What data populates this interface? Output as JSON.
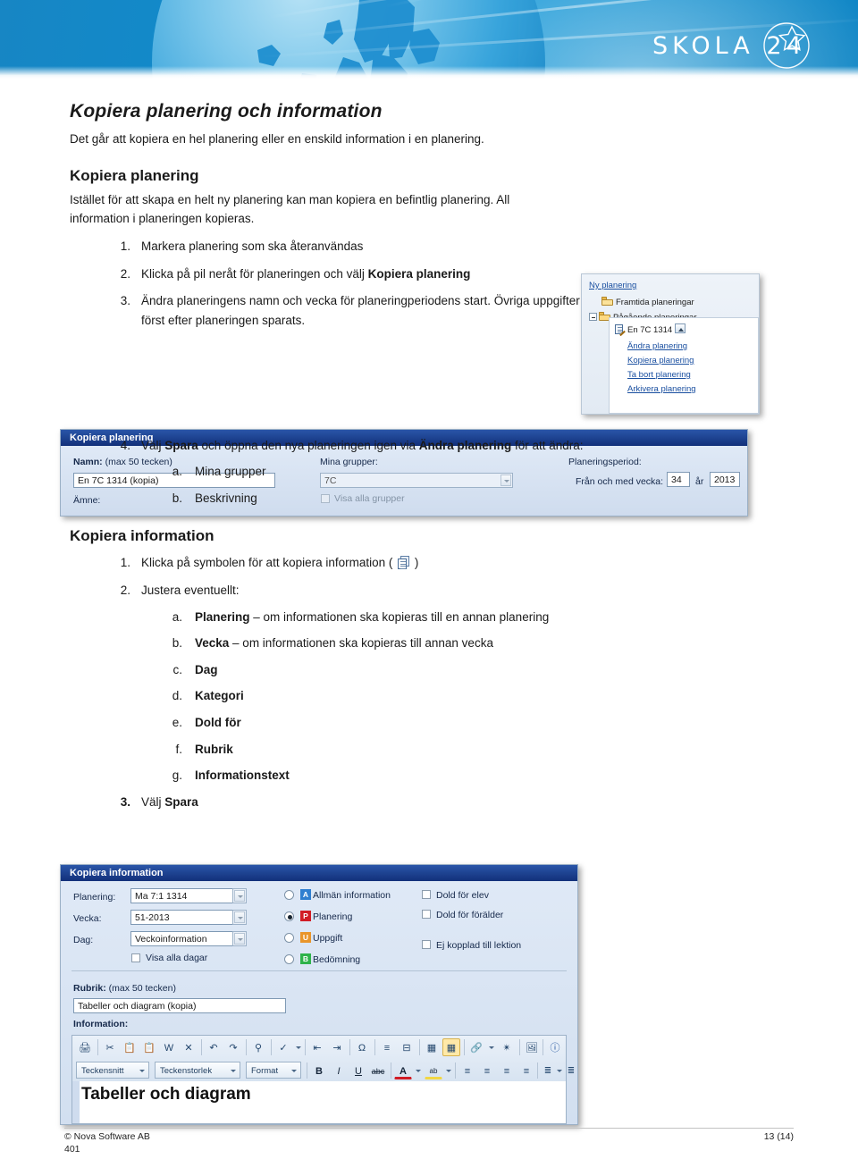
{
  "header": {
    "logo_text": "SKOLA 24",
    "logo_name": "skola24-logo"
  },
  "document": {
    "title": "Kopiera planering och information",
    "lead": "Det går att kopiera en hel planering eller en enskild information i en planering.",
    "section1": {
      "heading": "Kopiera planering",
      "paragraph": "Istället för att skapa en helt ny planering kan man kopiera en befintlig planering. All information i planeringen kopieras.",
      "steps": [
        {
          "num": "1.",
          "text": "Markera planering som ska återanvändas"
        },
        {
          "num": "2.",
          "pre": "Klicka på pil neråt för planeringen och välj ",
          "bold": "Kopiera planering",
          "post": ""
        },
        {
          "num": "3.",
          "text": "Ändra planeringens namn och vecka för planeringperiodens start. Övriga uppgifter kan ändras först efter planeringen sparats."
        },
        {
          "num": "4.",
          "pre": "Välj ",
          "bold": "Spara",
          "mid": " och öppna den nya planeringen igen via ",
          "bold2": "Ändra planering",
          "post": " för att ändra:"
        }
      ],
      "substeps4": [
        {
          "num": "a.",
          "text": "Mina grupper"
        },
        {
          "num": "b.",
          "text": "Beskrivning"
        }
      ]
    },
    "section2": {
      "heading": "Kopiera information",
      "step1_pre": "Klicka på symbolen för att kopiera information ( ",
      "step1_post": " )",
      "step1_num": "1.",
      "step1_icon": "copy-information-icon",
      "step2_num": "2.",
      "step2_text": "Justera eventuellt:",
      "substeps": [
        {
          "num": "a.",
          "bold": "Planering",
          "rest": " – om informationen ska kopieras till en annan planering"
        },
        {
          "num": "b.",
          "bold": "Vecka",
          "rest": " – om informationen ska kopieras till annan vecka"
        },
        {
          "num": "c.",
          "bold": "Dag",
          "rest": ""
        },
        {
          "num": "d.",
          "bold": "Kategori",
          "rest": ""
        },
        {
          "num": "e.",
          "bold": "Dold för",
          "rest": ""
        },
        {
          "num": "f.",
          "bold": "Rubrik",
          "rest": ""
        },
        {
          "num": "g.",
          "bold": "Informationstext",
          "rest": ""
        }
      ],
      "step3_num": "3.",
      "step3_pre": "Välj ",
      "step3_bold": "Spara"
    }
  },
  "tree_screenshot": {
    "new_planning_link": "Ny planering",
    "folder_future": "Framtida planeringar",
    "folder_ongoing": "Pågående planeringar",
    "planning_item": "En 7C 1314",
    "menu_items": [
      "Ändra planering",
      "Kopiera planering",
      "Ta bort planering",
      "Arkivera planering"
    ]
  },
  "kopiera_planering_dialog": {
    "title": "Kopiera planering",
    "name_label_bold": "Namn:",
    "name_label_rest": " (max 50 tecken)",
    "name_value": "En 7C 1314 (kopia)",
    "subject_label": "Ämne:",
    "groups_label": "Mina grupper:",
    "groups_value": "7C",
    "show_all_groups": "Visa alla grupper",
    "period_label": "Planeringsperiod:",
    "from_week_label": "Från och med vecka:",
    "week_value": "34",
    "year_label": "år",
    "year_value": "2013"
  },
  "kopiera_information_dialog": {
    "title": "Kopiera information",
    "planning_label": "Planering:",
    "planning_value": "Ma 7:1 1314",
    "week_label": "Vecka:",
    "week_value": "51-2013",
    "day_label": "Dag:",
    "day_value": "Veckoinformation",
    "show_all_days": "Visa alla dagar",
    "radios": [
      {
        "tag": "A",
        "label": "Allmän information",
        "color": "#2f7fd0",
        "selected": false
      },
      {
        "tag": "P",
        "label": "Planering",
        "color": "#d11d26",
        "selected": true
      },
      {
        "tag": "U",
        "label": "Uppgift",
        "color": "#e9952a",
        "selected": false
      },
      {
        "tag": "B",
        "label": "Bedömning",
        "color": "#2eb34a",
        "selected": false
      }
    ],
    "checkboxes": [
      {
        "label": "Dold för elev",
        "checked": false
      },
      {
        "label": "Dold för förälder",
        "checked": false
      },
      {
        "label": "Ej kopplad till lektion",
        "checked": false
      }
    ],
    "rubrik_label_bold": "Rubrik:",
    "rubrik_label_rest": " (max 50 tecken)",
    "rubrik_value": "Tabeller och diagram (kopia)",
    "information_label": "Information:",
    "editor_content_heading": "Tabeller och diagram",
    "toolbar_row1": [
      "print-icon",
      "cut-icon",
      "copy-icon",
      "paste-icon",
      "paste-from-word-icon",
      "delete-icon",
      "undo-icon",
      "redo-icon",
      "find-icon",
      "spellcheck-icon",
      "outdent-icon",
      "indent-icon",
      "special-character-icon",
      "horizontal-rule-icon",
      "page-break-icon",
      "insert-table-icon",
      "table-grid-icon",
      "link-icon",
      "unlink-icon",
      "image-icon",
      "help-icon"
    ],
    "toolbar_row2": {
      "font_label": "Teckensnitt",
      "size_label": "Teckenstorlek",
      "format_label": "Format",
      "bold": "B",
      "italic": "I",
      "underline": "U",
      "strike": "abc",
      "text_color": "A",
      "highlight": "ab"
    }
  },
  "footer": {
    "copyright": "© Nova Software AB",
    "page": "13 (14)",
    "doc_number": "401"
  }
}
